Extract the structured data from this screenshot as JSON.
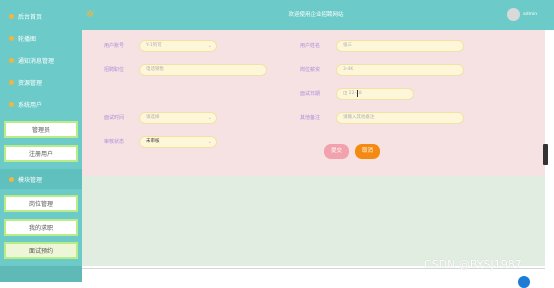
{
  "header": {
    "title": "欢迎使用企业招聘网站",
    "user_name": "admin"
  },
  "sidebar": {
    "items": [
      {
        "label": "后台首页"
      },
      {
        "label": "轮播图"
      },
      {
        "label": "通知消息管理"
      },
      {
        "label": "资源管理"
      },
      {
        "label": "系统用户"
      }
    ],
    "system_sub": [
      "管理员",
      "注册用户"
    ],
    "module": {
      "label": "模块管理"
    },
    "module_sub": [
      "岗位管理",
      "我的求职",
      "面试预约"
    ]
  },
  "form": {
    "user_account": {
      "label": "用户账号",
      "value": "Y-1列可"
    },
    "user_name": {
      "label": "用户姓名",
      "value": "张三"
    },
    "job_title": {
      "label": "招聘职位",
      "value": "电话销售"
    },
    "job_salary": {
      "label": "岗位薪资",
      "value": "3-4K"
    },
    "interview_date": {
      "label": "面试日期",
      "value": "22-18"
    },
    "interview_time": {
      "label": "面试时间",
      "value": "请选择"
    },
    "other_note": {
      "label": "其他备注",
      "value": "请输入其他备注"
    },
    "review_status": {
      "label": "审核状态",
      "value": "未审核"
    },
    "submit_label": "提交",
    "cancel_label": "取消"
  },
  "watermark": "CSDN @BYSJ1987",
  "colors": {
    "sidebar": "#6ccbc9",
    "accent": "#f3b53f",
    "form_bg": "#f6e2e2",
    "submit": "#f2a2ad",
    "cancel": "#f58a12",
    "label": "#b28cdc"
  }
}
